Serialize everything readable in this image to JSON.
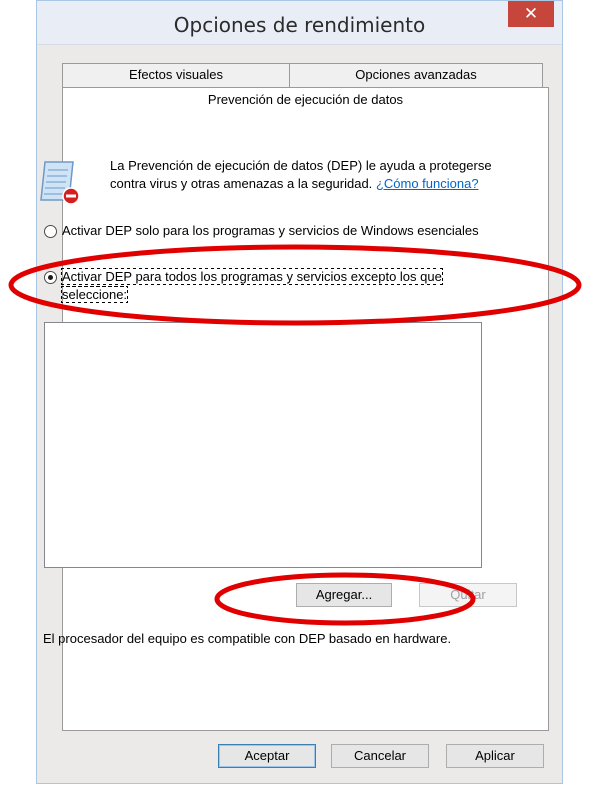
{
  "window": {
    "title": "Opciones de rendimiento",
    "close_glyph": "✕"
  },
  "tabs": {
    "visual_effects": "Efectos visuales",
    "advanced": "Opciones avanzadas",
    "dep": "Prevención de ejecución de datos"
  },
  "dep": {
    "icon": "dep-shield-icon",
    "description": "La Prevención de ejecución de datos (DEP) le ayuda a protegerse contra virus y otras amenazas a la seguridad.",
    "help_link": "¿Cómo funciona?",
    "option_essential": "Activar DEP solo para los programas y servicios de Windows esenciales",
    "option_all": "Activar DEP para todos los programas y servicios excepto los que seleccione:",
    "selected_option": "option_all",
    "exceptions": [],
    "add_button": "Agregar...",
    "remove_button": "Quitar",
    "hardware_support": "El procesador del equipo es compatible con DEP basado en hardware."
  },
  "footer": {
    "ok": "Aceptar",
    "cancel": "Cancelar",
    "apply": "Aplicar"
  },
  "colors": {
    "annotation": "#e00000",
    "close_button": "#c7463c",
    "link": "#0066cc"
  }
}
